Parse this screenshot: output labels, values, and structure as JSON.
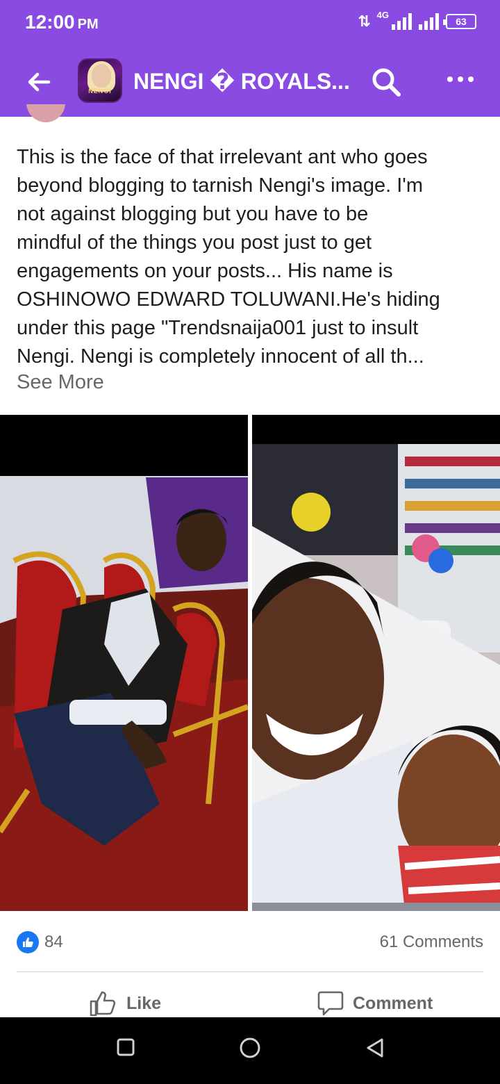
{
  "status_bar": {
    "time": "12:00",
    "ampm": "PM",
    "network_label": "4G",
    "battery": "63"
  },
  "header": {
    "title": "NENGI � ROYALS...",
    "avatar_text": "NENGI"
  },
  "post": {
    "lines": [
      "This is the face of that irrelevant ant who goes",
      "beyond blogging to tarnish Nengi's image. I'm",
      "not against blogging but you have to be",
      "mindful of the things you post just to get",
      "engagements on your posts...  His name is",
      "OSHINOWO EDWARD TOLUWANI.He's hiding",
      "under this page \"Trendsnaija001 just to insult",
      "Nengi. Nengi is completely innocent of all th..."
    ],
    "see_more": "See More",
    "photos": [
      "person-seated-in-red-chairs",
      "selfie-with-child-in-store"
    ]
  },
  "engagement": {
    "reactions_count": "84",
    "comments_count": "61 Comments"
  },
  "actions": {
    "like_label": "Like",
    "comment_label": "Comment"
  },
  "colors": {
    "brand_purple": "#8a4be3",
    "facebook_blue": "#1877f2",
    "meta_gray": "#65676b"
  }
}
